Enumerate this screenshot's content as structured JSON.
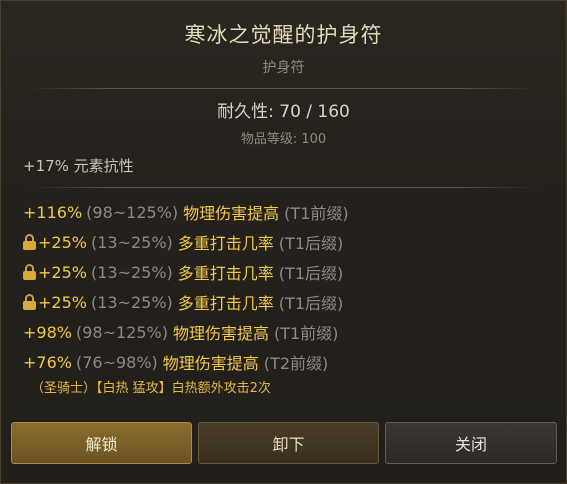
{
  "item": {
    "name": "寒冰之觉醒的护身符",
    "type": "护身符",
    "durability_text": "耐久性: 70 / 160",
    "item_level_text": "物品等级: 100",
    "implicit": "+17% 元素抗性"
  },
  "affixes": [
    {
      "value": "+116%",
      "range": "(98~125%)",
      "name": "物理伤害提高",
      "tier": "(T1前缀)",
      "locked": false
    },
    {
      "value": "+25%",
      "range": "(13~25%)",
      "name": "多重打击几率",
      "tier": "(T1后缀)",
      "locked": true
    },
    {
      "value": "+25%",
      "range": "(13~25%)",
      "name": "多重打击几率",
      "tier": "(T1后缀)",
      "locked": true
    },
    {
      "value": "+25%",
      "range": "(13~25%)",
      "name": "多重打击几率",
      "tier": "(T1后缀)",
      "locked": true
    },
    {
      "value": "+98%",
      "range": "(98~125%)",
      "name": "物理伤害提高",
      "tier": "(T1前缀)",
      "locked": false
    },
    {
      "value": "+76%",
      "range": "(76~98%)",
      "name": "物理伤害提高",
      "tier": "(T2前缀)",
      "locked": false
    }
  ],
  "set_line": "（圣骑士）【白热 猛攻】白热额外攻击2次",
  "buttons": {
    "unlock": "解锁",
    "unequip": "卸下",
    "close": "关闭"
  },
  "colors": {
    "affix_value": "#f0c84a",
    "range_text": "#8c8a85",
    "lock": "#d9a93c"
  },
  "icons": {
    "lock": "lock-icon"
  }
}
